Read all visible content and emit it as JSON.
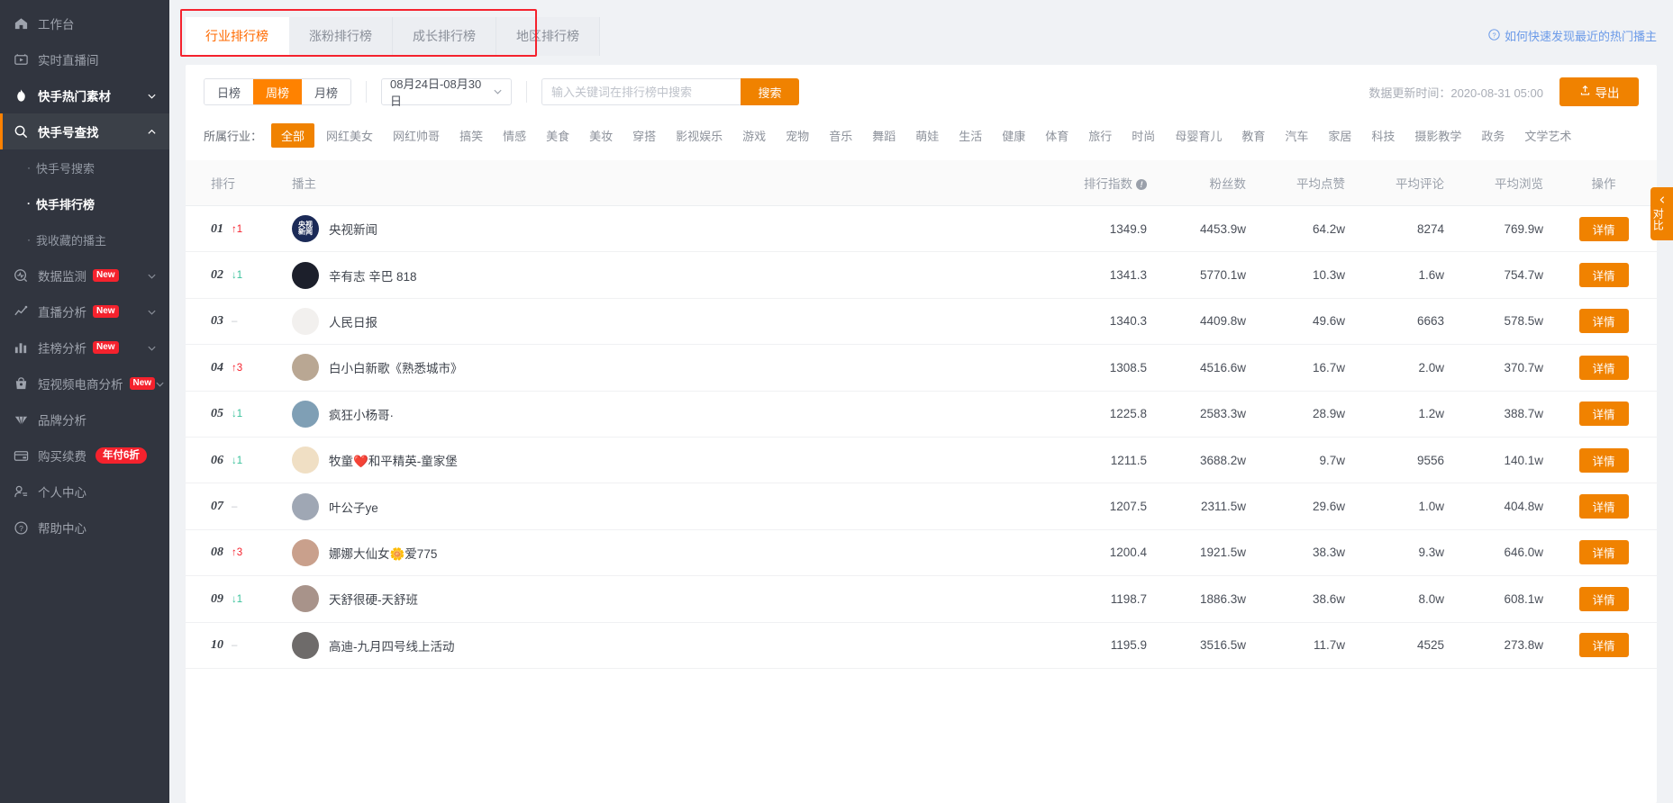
{
  "sidebar": {
    "items": [
      {
        "label": "工作台",
        "icon": "home-icon",
        "state": "normal"
      },
      {
        "label": "实时直播间",
        "icon": "live-room-icon",
        "state": "normal"
      },
      {
        "label": "快手热门素材",
        "icon": "fire-icon",
        "state": "bold",
        "chevron": "chevron-down-icon"
      },
      {
        "label": "快手号查找",
        "icon": "search-icon",
        "state": "active",
        "chevron": "chevron-up-icon"
      }
    ],
    "sub_items": [
      {
        "label": "快手号搜索",
        "state": "normal"
      },
      {
        "label": "快手排行榜",
        "state": "current"
      },
      {
        "label": "我收藏的播主",
        "state": "normal"
      }
    ],
    "items2": [
      {
        "label": "数据监测",
        "icon": "monitor-icon",
        "badge": "New",
        "chevron": "chevron-down-icon"
      },
      {
        "label": "直播分析",
        "icon": "line-chart-icon",
        "badge": "New",
        "chevron": "chevron-down-icon"
      },
      {
        "label": "挂榜分析",
        "icon": "bar-chart-icon",
        "badge": "New",
        "chevron": "chevron-down-icon"
      },
      {
        "label": "短视频电商分析",
        "icon": "bag-icon",
        "badge": "New",
        "chevron": "chevron-down-icon"
      },
      {
        "label": "品牌分析",
        "icon": "diamond-icon",
        "badge": "",
        "chevron": ""
      },
      {
        "label": "购买续费",
        "icon": "card-icon",
        "sale_badge": "年付6折"
      },
      {
        "label": "个人中心",
        "icon": "user-icon"
      },
      {
        "label": "帮助中心",
        "icon": "question-icon"
      }
    ]
  },
  "tabs": [
    {
      "label": "行业排行榜",
      "active": true
    },
    {
      "label": "涨粉排行榜",
      "active": false
    },
    {
      "label": "成长排行榜",
      "active": false
    },
    {
      "label": "地区排行榜",
      "active": false
    }
  ],
  "help_link": {
    "label": "如何快速发现最近的热门播主",
    "icon": "question-circle-icon"
  },
  "filters": {
    "period": [
      {
        "label": "日榜",
        "on": false
      },
      {
        "label": "周榜",
        "on": true
      },
      {
        "label": "月榜",
        "on": false
      }
    ],
    "date_range": "08月24日-08月30日",
    "search_placeholder": "输入关键词在排行榜中搜索",
    "search_value": "",
    "search_button": "搜索",
    "update_time": "数据更新时间：2020-08-31 05:00",
    "export_button": "导出"
  },
  "industry": {
    "label": "所属行业：",
    "options": [
      {
        "label": "全部",
        "on": true
      },
      {
        "label": "网红美女",
        "on": false
      },
      {
        "label": "网红帅哥",
        "on": false
      },
      {
        "label": "搞笑",
        "on": false
      },
      {
        "label": "情感",
        "on": false
      },
      {
        "label": "美食",
        "on": false
      },
      {
        "label": "美妆",
        "on": false
      },
      {
        "label": "穿搭",
        "on": false
      },
      {
        "label": "影视娱乐",
        "on": false
      },
      {
        "label": "游戏",
        "on": false
      },
      {
        "label": "宠物",
        "on": false
      },
      {
        "label": "音乐",
        "on": false
      },
      {
        "label": "舞蹈",
        "on": false
      },
      {
        "label": "萌娃",
        "on": false
      },
      {
        "label": "生活",
        "on": false
      },
      {
        "label": "健康",
        "on": false
      },
      {
        "label": "体育",
        "on": false
      },
      {
        "label": "旅行",
        "on": false
      },
      {
        "label": "时尚",
        "on": false
      },
      {
        "label": "母婴育儿",
        "on": false
      },
      {
        "label": "教育",
        "on": false
      },
      {
        "label": "汽车",
        "on": false
      },
      {
        "label": "家居",
        "on": false
      },
      {
        "label": "科技",
        "on": false
      },
      {
        "label": "摄影教学",
        "on": false
      },
      {
        "label": "政务",
        "on": false
      },
      {
        "label": "文学艺术",
        "on": false
      }
    ]
  },
  "table": {
    "headers": {
      "rank": "排行",
      "host": "播主",
      "index": "排行指数",
      "fans": "粉丝数",
      "likes": "平均点赞",
      "comments": "平均评论",
      "views": "平均浏览",
      "action": "操作"
    },
    "detail_label": "详情",
    "rows": [
      {
        "rank": "01",
        "delta": "1",
        "dir": "up",
        "name": "央视新闻",
        "avatar_text": "央视\n新闻",
        "avatar_bg": "#1b2a57",
        "index": "1349.9",
        "fans": "4453.9w",
        "likes": "64.2w",
        "comments": "8274",
        "views": "769.9w"
      },
      {
        "rank": "02",
        "delta": "1",
        "dir": "down",
        "name": "辛有志 辛巴 818",
        "avatar_text": "",
        "avatar_bg": "#1c1f2b",
        "index": "1341.3",
        "fans": "5770.1w",
        "likes": "10.3w",
        "comments": "1.6w",
        "views": "754.7w"
      },
      {
        "rank": "03",
        "delta": "",
        "dir": "flat",
        "name": "人民日报",
        "avatar_text": "",
        "avatar_bg": "#f2f0ee",
        "index": "1340.3",
        "fans": "4409.8w",
        "likes": "49.6w",
        "comments": "6663",
        "views": "578.5w"
      },
      {
        "rank": "04",
        "delta": "3",
        "dir": "up",
        "name": "白小白新歌《熟悉城市》",
        "avatar_text": "",
        "avatar_bg": "#b9a793",
        "index": "1308.5",
        "fans": "4516.6w",
        "likes": "16.7w",
        "comments": "2.0w",
        "views": "370.7w"
      },
      {
        "rank": "05",
        "delta": "1",
        "dir": "down",
        "name": "疯狂小杨哥·",
        "avatar_text": "",
        "avatar_bg": "#7f9fb5",
        "index": "1225.8",
        "fans": "2583.3w",
        "likes": "28.9w",
        "comments": "1.2w",
        "views": "388.7w"
      },
      {
        "rank": "06",
        "delta": "1",
        "dir": "down",
        "name": "牧童❤️和平精英-童家堡",
        "avatar_text": "",
        "avatar_bg": "#f0dfc4",
        "index": "1211.5",
        "fans": "3688.2w",
        "likes": "9.7w",
        "comments": "9556",
        "views": "140.1w"
      },
      {
        "rank": "07",
        "delta": "",
        "dir": "flat",
        "name": "叶公子ye",
        "avatar_text": "",
        "avatar_bg": "#9fa7b4",
        "index": "1207.5",
        "fans": "2311.5w",
        "likes": "29.6w",
        "comments": "1.0w",
        "views": "404.8w"
      },
      {
        "rank": "08",
        "delta": "3",
        "dir": "up",
        "name": "娜娜大仙女🌼爱775",
        "avatar_text": "",
        "avatar_bg": "#c9a08c",
        "index": "1200.4",
        "fans": "1921.5w",
        "likes": "38.3w",
        "comments": "9.3w",
        "views": "646.0w"
      },
      {
        "rank": "09",
        "delta": "1",
        "dir": "down",
        "name": "天舒很硬-天舒班",
        "avatar_text": "",
        "avatar_bg": "#a8938a",
        "index": "1198.7",
        "fans": "1886.3w",
        "likes": "38.6w",
        "comments": "8.0w",
        "views": "608.1w"
      },
      {
        "rank": "10",
        "delta": "",
        "dir": "flat",
        "name": "高迪-九月四号线上活动",
        "avatar_text": "",
        "avatar_bg": "#6e6b6a",
        "index": "1195.9",
        "fans": "3516.5w",
        "likes": "11.7w",
        "comments": "4525",
        "views": "273.8w"
      }
    ]
  },
  "compare_tab": {
    "label": "对比",
    "icon": "chevron-left-icon"
  },
  "colors": {
    "accent": "#f08200",
    "sidebar_bg": "#31353f",
    "highlight_red": "#f5222d",
    "up": "#f5222d",
    "down": "#3ac29b"
  }
}
